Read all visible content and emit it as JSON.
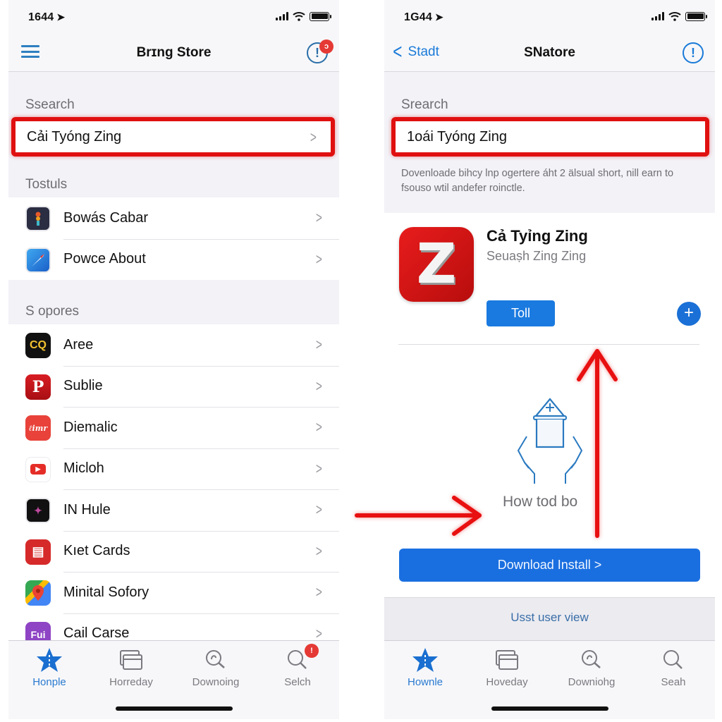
{
  "colors": {
    "accent": "#1a7ad8",
    "highlight_red": "#e01010",
    "annotation_arrow": "#e81010",
    "badge_red": "#e53935",
    "app_icon_red": "#d41414"
  },
  "left_screen": {
    "status_bar": {
      "time": "1644",
      "location_icon": "location-arrow-icon"
    },
    "nav": {
      "title": "Brɪng Store",
      "left_icon": "hamburger-menu-icon",
      "right_icon": "info-alert-icon",
      "badge": "ↄ"
    },
    "search_section": {
      "label": "Ssearch",
      "value": "Cải Tyóng Zing"
    },
    "tools_section": {
      "label": "Tostuls",
      "items": [
        {
          "label": "Bowás Cabar",
          "icon": "traffic-light-icon"
        },
        {
          "label": "Powce About",
          "icon": "compass-icon"
        }
      ]
    },
    "supports_section": {
      "label": "S opores",
      "items": [
        {
          "label": "Aree",
          "icon": "cq-logo-icon",
          "glyph": "CQ"
        },
        {
          "label": "Sublie",
          "icon": "pinterest-icon",
          "glyph": "P"
        },
        {
          "label": "Diemalic",
          "icon": "script-logo-icon",
          "glyph": "ℓimr"
        },
        {
          "label": "Micloh",
          "icon": "youtube-play-icon",
          "glyph": "▶"
        },
        {
          "label": "IN Hule",
          "icon": "dark-app-icon",
          "glyph": "✦"
        },
        {
          "label": "Kıet Cards",
          "icon": "card-tray-icon",
          "glyph": "▤"
        },
        {
          "label": "Minital Sofory",
          "icon": "maps-pin-icon",
          "glyph": ""
        },
        {
          "label": "Cail Carse",
          "icon": "fui-logo-icon",
          "glyph": "Fui"
        }
      ]
    },
    "tab_bar": {
      "tabs": [
        {
          "label": "Honple",
          "icon": "star-icon",
          "active": true
        },
        {
          "label": "Horreday",
          "icon": "cards-stack-icon",
          "active": false
        },
        {
          "label": "Downoing",
          "icon": "head-search-icon",
          "active": false
        },
        {
          "label": "Selch",
          "icon": "magnifier-icon",
          "active": false,
          "badge": "!"
        }
      ]
    }
  },
  "right_screen": {
    "status_bar": {
      "time": "1G44",
      "location_icon": "location-arrow-icon"
    },
    "nav": {
      "back_label": "Stadt",
      "title": "SNatore",
      "right_icon": "info-alert-icon"
    },
    "search_section": {
      "label": "Srearch",
      "value": "1oái Tyóng Zing"
    },
    "description": "Dovenloade bihcy lnp ogertere áht 2 älsual short, nill earn to fsouso wtil andefer roinctle.",
    "app": {
      "icon_letter": "Z",
      "name": "Cả Tyỉng Zing",
      "subtitle": "Seuaṣh Zing Zing",
      "get_button": "Toll",
      "plus_button": "+"
    },
    "illustration_caption": "How tod bo",
    "download_button": "Download Install >",
    "user_view_link": "Usst user view",
    "tab_bar": {
      "tabs": [
        {
          "label": "Hownle",
          "icon": "star-icon",
          "active": true
        },
        {
          "label": "Hoveday",
          "icon": "cards-stack-icon",
          "active": false
        },
        {
          "label": "Downiohg",
          "icon": "head-search-icon",
          "active": false
        },
        {
          "label": "Seah",
          "icon": "magnifier-icon",
          "active": false
        }
      ]
    }
  }
}
